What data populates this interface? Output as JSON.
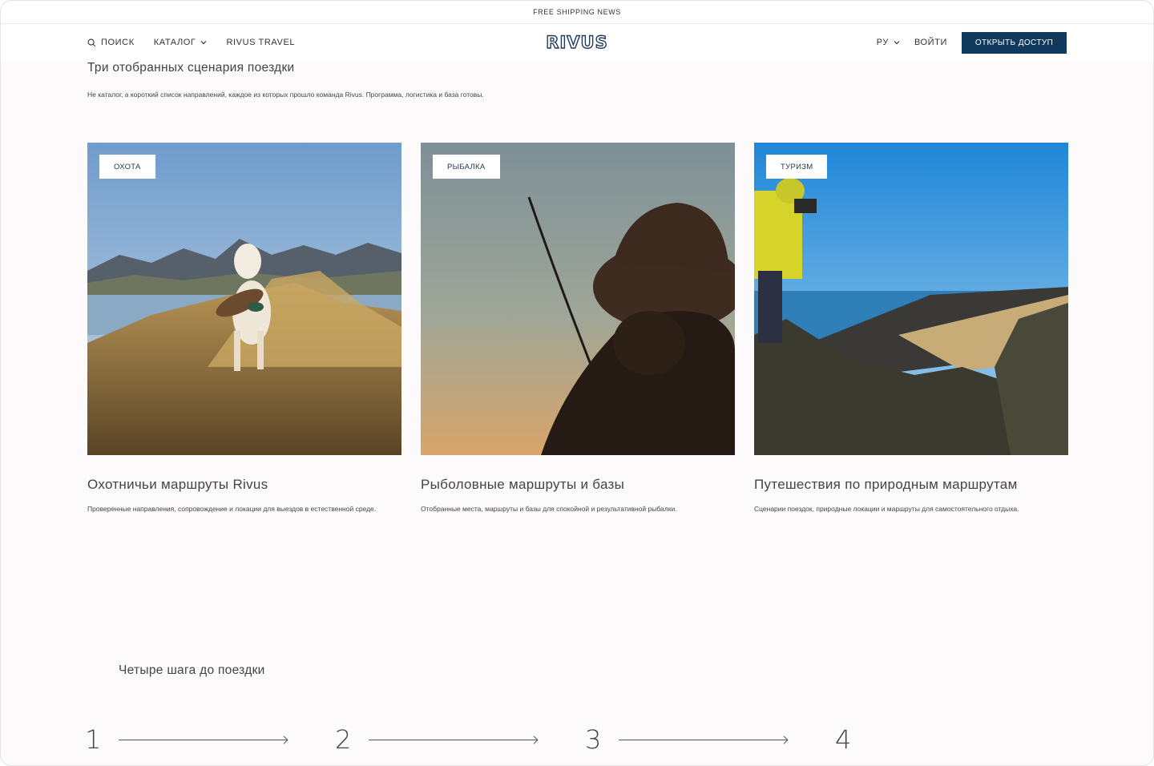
{
  "promo": {
    "text": "FREE SHIPPING NEWS"
  },
  "header": {
    "search_label": "ПОИСК",
    "catalog_label": "КАТАЛОГ",
    "travel_label": "RIVUS TRAVEL",
    "logo": "RIVUS",
    "lang_label": "РУ",
    "login_label": "ВОЙТИ",
    "cta_label": "ОТКРЫТЬ ДОСТУП"
  },
  "routes": {
    "title": "Три отобранных сценария поездки",
    "subtitle": "Не каталог, а короткий список направлений, каждое из которых прошло команда Rivus. Программа, логистика и база готовы.",
    "cards": [
      {
        "badge": "ОХОТА",
        "title": "Охотничьи маршруты Rivus",
        "desc": "Проверенные направления, сопровождение и локации для выездов в естественной среде."
      },
      {
        "badge": "РЫБАЛКА",
        "title": "Рыболовные маршруты и базы",
        "desc": "Отобранные места, маршруты и базы для спокойной и результативной рыбалки."
      },
      {
        "badge": "ТУРИЗМ",
        "title": "Путешествия по природным маршрутам",
        "desc": "Сценарии поездок, природные локации и маршруты для самостоятельного отдыха."
      }
    ]
  },
  "steps": {
    "title": "Четыре шага до поездки",
    "numbers": [
      "1",
      "2",
      "3",
      "4"
    ]
  },
  "colors": {
    "accent": "#0f3a5e",
    "logo": "#203a5a",
    "background": "#fcfafb"
  },
  "icons": {
    "search": "search-icon",
    "chevron": "chevron-down-icon",
    "arrow": "arrow-right-icon"
  }
}
